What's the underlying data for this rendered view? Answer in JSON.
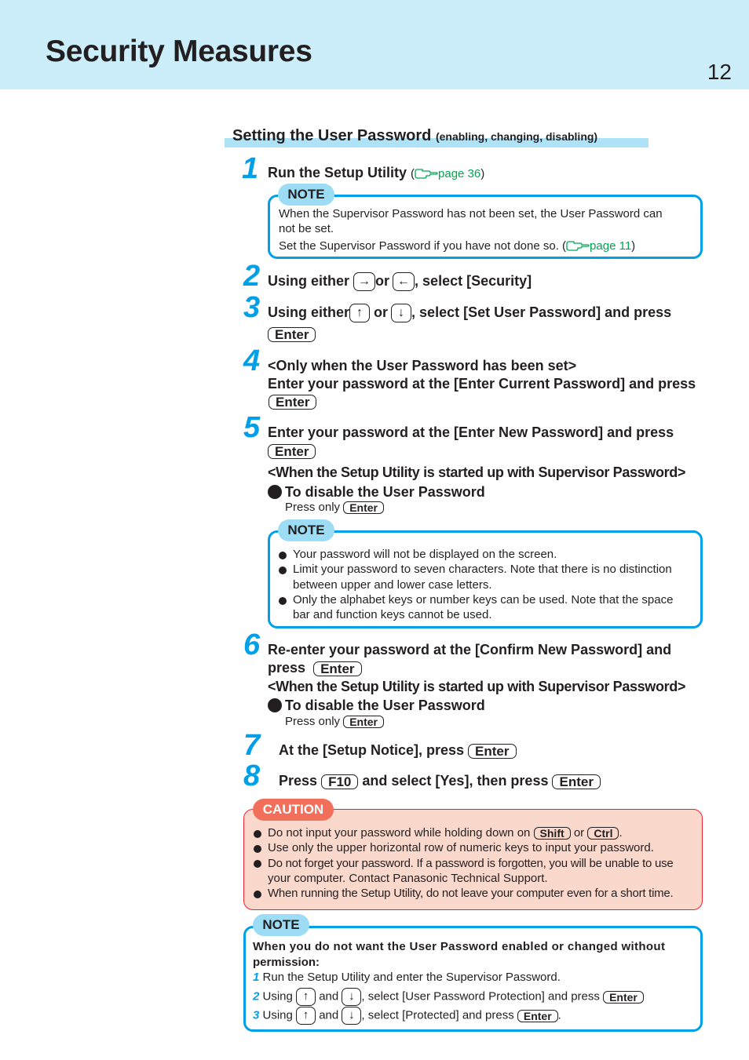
{
  "header": {
    "title": "Security Measures",
    "page_number": "12",
    "band_color": "#cbeefa"
  },
  "section": {
    "title": "Setting the User Password",
    "subtitle": "(enabling, changing, disabling)"
  },
  "colors": {
    "accent_blue": "#00a0e9",
    "note_tag": "#9ddcf5",
    "caution_border": "#e8242f",
    "caution_bg": "#fbd8cc",
    "caution_tag": "#f26f5b",
    "ref_green": "#00a651"
  },
  "steps": [
    {
      "num": "1",
      "text": "Run the Setup Utility",
      "ref_open": "(",
      "ref": "page 36",
      "ref_close": ")"
    },
    {
      "num": "2",
      "text_a": "Using either",
      "or": "or",
      "text_b": ", select [Security]",
      "key_a": "→",
      "key_b": "←"
    },
    {
      "num": "3",
      "text_a": "Using either",
      "or": "or",
      "text_b": ", select [Set User Password] and press",
      "key_a": "↑",
      "key_b": "↓",
      "key": "Enter"
    },
    {
      "num": "4",
      "line1": "<Only when the User Password has been set>",
      "line2": "Enter your password at the [Enter Current Password] and press",
      "key": "Enter"
    },
    {
      "num": "5",
      "line1": "Enter your password at the [Enter New Password] and press",
      "key": "Enter",
      "cond": "<When the Setup Utility is started up with Supervisor Password>",
      "bullet": "To disable the User Password",
      "press_only": "Press only",
      "press_key": "Enter"
    },
    {
      "num": "6",
      "line1": "Re-enter your password at the [Confirm New Password] and",
      "line2": "press",
      "key": "Enter",
      "cond": "<When the Setup Utility is started up with Supervisor Password>",
      "bullet": "To disable the User Password",
      "press_only": "Press only",
      "press_key": "Enter"
    },
    {
      "num": "7",
      "text": "At the [Setup Notice], press",
      "key": "Enter"
    },
    {
      "num": "8",
      "text_a": "Press",
      "key_a": "F10",
      "text_b": "and select [Yes], then press",
      "key_b": "Enter"
    }
  ],
  "note1": {
    "tag": "NOTE",
    "line1": "When the Supervisor Password has not been set, the User Password can",
    "line2": "not be set.",
    "line3": "Set the Supervisor Password if you have not done so. (",
    "ref": "page 11",
    "ref_close": ")"
  },
  "note2": {
    "tag": "NOTE",
    "items": [
      "Your password will not be displayed on the screen.",
      "Limit your password to seven characters.  Note that there is no distinction",
      "between upper and lower case letters.",
      "Only the alphabet keys or number keys can be used.  Note that the space",
      "bar and function keys cannot be used."
    ]
  },
  "caution": {
    "tag": "CAUTION",
    "item1_a": "Do not input your password while holding down on",
    "item1_key_a": "Shift",
    "item1_or": "or",
    "item1_key_b": "Ctrl",
    "item1_end": ".",
    "item2": "Use only the upper horizontal row of numeric keys to input your password.",
    "item3_l1": "Do not forget your password.  If a password is forgotten, you will be unable to use",
    "item3_l2": "your computer.  Contact Panasonic Technical Support.",
    "item4": "When running the Setup Utility, do not leave your computer even for a short time."
  },
  "note3": {
    "tag": "NOTE",
    "heading_l1": "When you do not want the User Password enabled or changed without",
    "heading_l2": "permission:",
    "s1_num": "1",
    "s1": "Run the Setup Utility and enter the Supervisor Password.",
    "s2_num": "2",
    "s2_a": "Using",
    "s2_and": "and",
    "s2_b": ", select [User Password Protection] and press",
    "s2_key": "Enter",
    "s3_num": "3",
    "s3_a": "Using",
    "s3_and": "and",
    "s3_b": ", select [Protected] and press",
    "s3_key": "Enter",
    "s3_end": ".",
    "up": "↑",
    "down": "↓"
  }
}
